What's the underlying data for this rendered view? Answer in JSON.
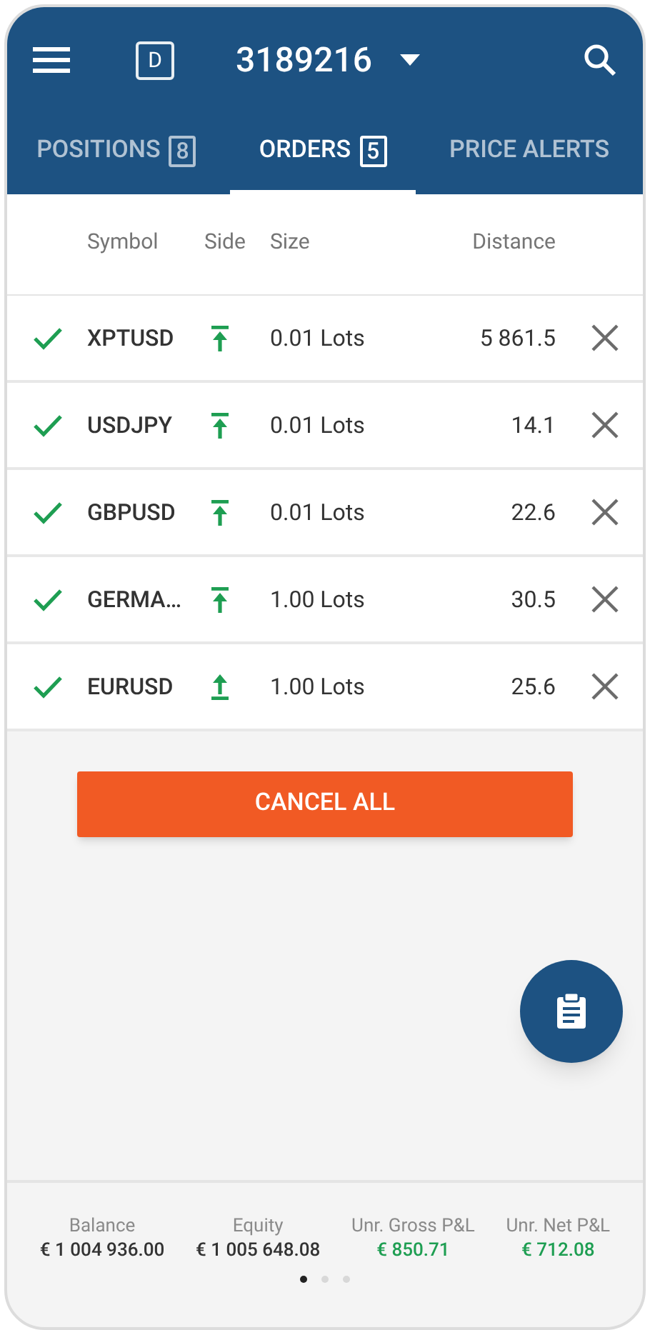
{
  "header": {
    "account_badge": "D",
    "account_number": "3189216"
  },
  "tabs": [
    {
      "label": "POSITIONS",
      "count": "8",
      "selected": false
    },
    {
      "label": "ORDERS",
      "count": "5",
      "selected": true
    },
    {
      "label": "PRICE ALERTS",
      "selected": false
    }
  ],
  "table": {
    "columns": [
      "Symbol",
      "Side",
      "Size",
      "Distance"
    ],
    "rows": [
      {
        "symbol": "XPTUSD",
        "side": {
          "kind": "bar-top"
        },
        "size": "0.01 Lots",
        "distance": "5 861.5"
      },
      {
        "symbol": "USDJPY",
        "side": {
          "kind": "bar-top"
        },
        "size": "0.01 Lots",
        "distance": "14.1"
      },
      {
        "symbol": "GBPUSD",
        "side": {
          "kind": "bar-top"
        },
        "size": "0.01 Lots",
        "distance": "22.6"
      },
      {
        "symbol": "GERMA…",
        "side": {
          "kind": "bar-top"
        },
        "size": "1.00 Lots",
        "distance": "30.5"
      },
      {
        "symbol": "EURUSD",
        "side": {
          "kind": "bar-bottom"
        },
        "size": "1.00 Lots",
        "distance": "25.6"
      }
    ]
  },
  "cancel_all_button": "CANCEL ALL",
  "summary": [
    {
      "label": "Balance",
      "value": "€ 1 004 936.00",
      "color": "#333333"
    },
    {
      "label": "Equity",
      "value": "€ 1 005 648.08",
      "color": "#333333"
    },
    {
      "label": "Unr. Gross P&L",
      "value": "€ 850.71",
      "color": "#1e9e52"
    },
    {
      "label": "Unr. Net P&L",
      "value": "€ 712.08",
      "color": "#1e9e52"
    }
  ],
  "pages": [
    {
      "selected": true
    },
    {
      "selected": false
    },
    {
      "selected": false
    }
  ]
}
